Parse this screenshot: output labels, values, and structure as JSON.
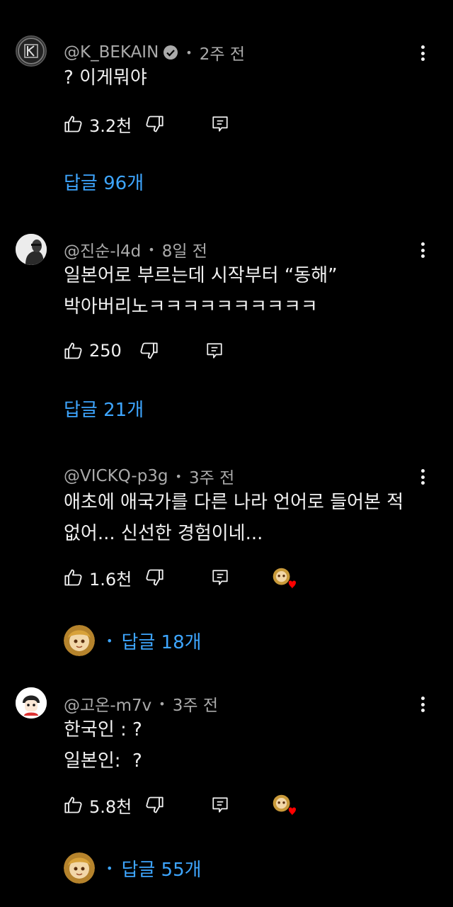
{
  "comments": [
    {
      "author": "@K_BEKAIN",
      "verified": true,
      "time": "2주 전",
      "lines": [
        "? 이게뭐야"
      ],
      "likes": "3.2천",
      "replies": "답글 96개",
      "has_heart": false,
      "reply_avatar": false
    },
    {
      "author": "@진순-l4d",
      "verified": false,
      "time": "8일 전",
      "lines": [
        "일본어로 부르는데 시작부터 “동해”",
        "박아버리노ㅋㅋㅋㅋㅋㅋㅋㅋㅋㅋ"
      ],
      "likes": "250",
      "replies": "답글 21개",
      "has_heart": false,
      "reply_avatar": false
    },
    {
      "author": "@VICKQ-p3g",
      "verified": false,
      "time": "3주 전",
      "lines": [
        "애초에 애국가를 다른 나라 언어로 들어본 적",
        "없어... 신선한 경험이네..."
      ],
      "likes": "1.6천",
      "replies": "답글 18개",
      "has_heart": true,
      "reply_avatar": true
    },
    {
      "author": "@고온-m7v",
      "verified": false,
      "time": "3주 전",
      "lines": [
        "한국인 : ?",
        "일본인:  ?"
      ],
      "likes": "5.8천",
      "replies": "답글 55개",
      "has_heart": true,
      "reply_avatar": true
    }
  ],
  "icons": {
    "like": "thumbs-up-icon",
    "dislike": "thumbs-down-icon",
    "reply": "reply-icon",
    "more": "more-vertical-icon"
  },
  "colors": {
    "background": "#000000",
    "reply_link": "#3ea6ff",
    "meta": "#aaaaaa",
    "heart": "#ff0000"
  }
}
